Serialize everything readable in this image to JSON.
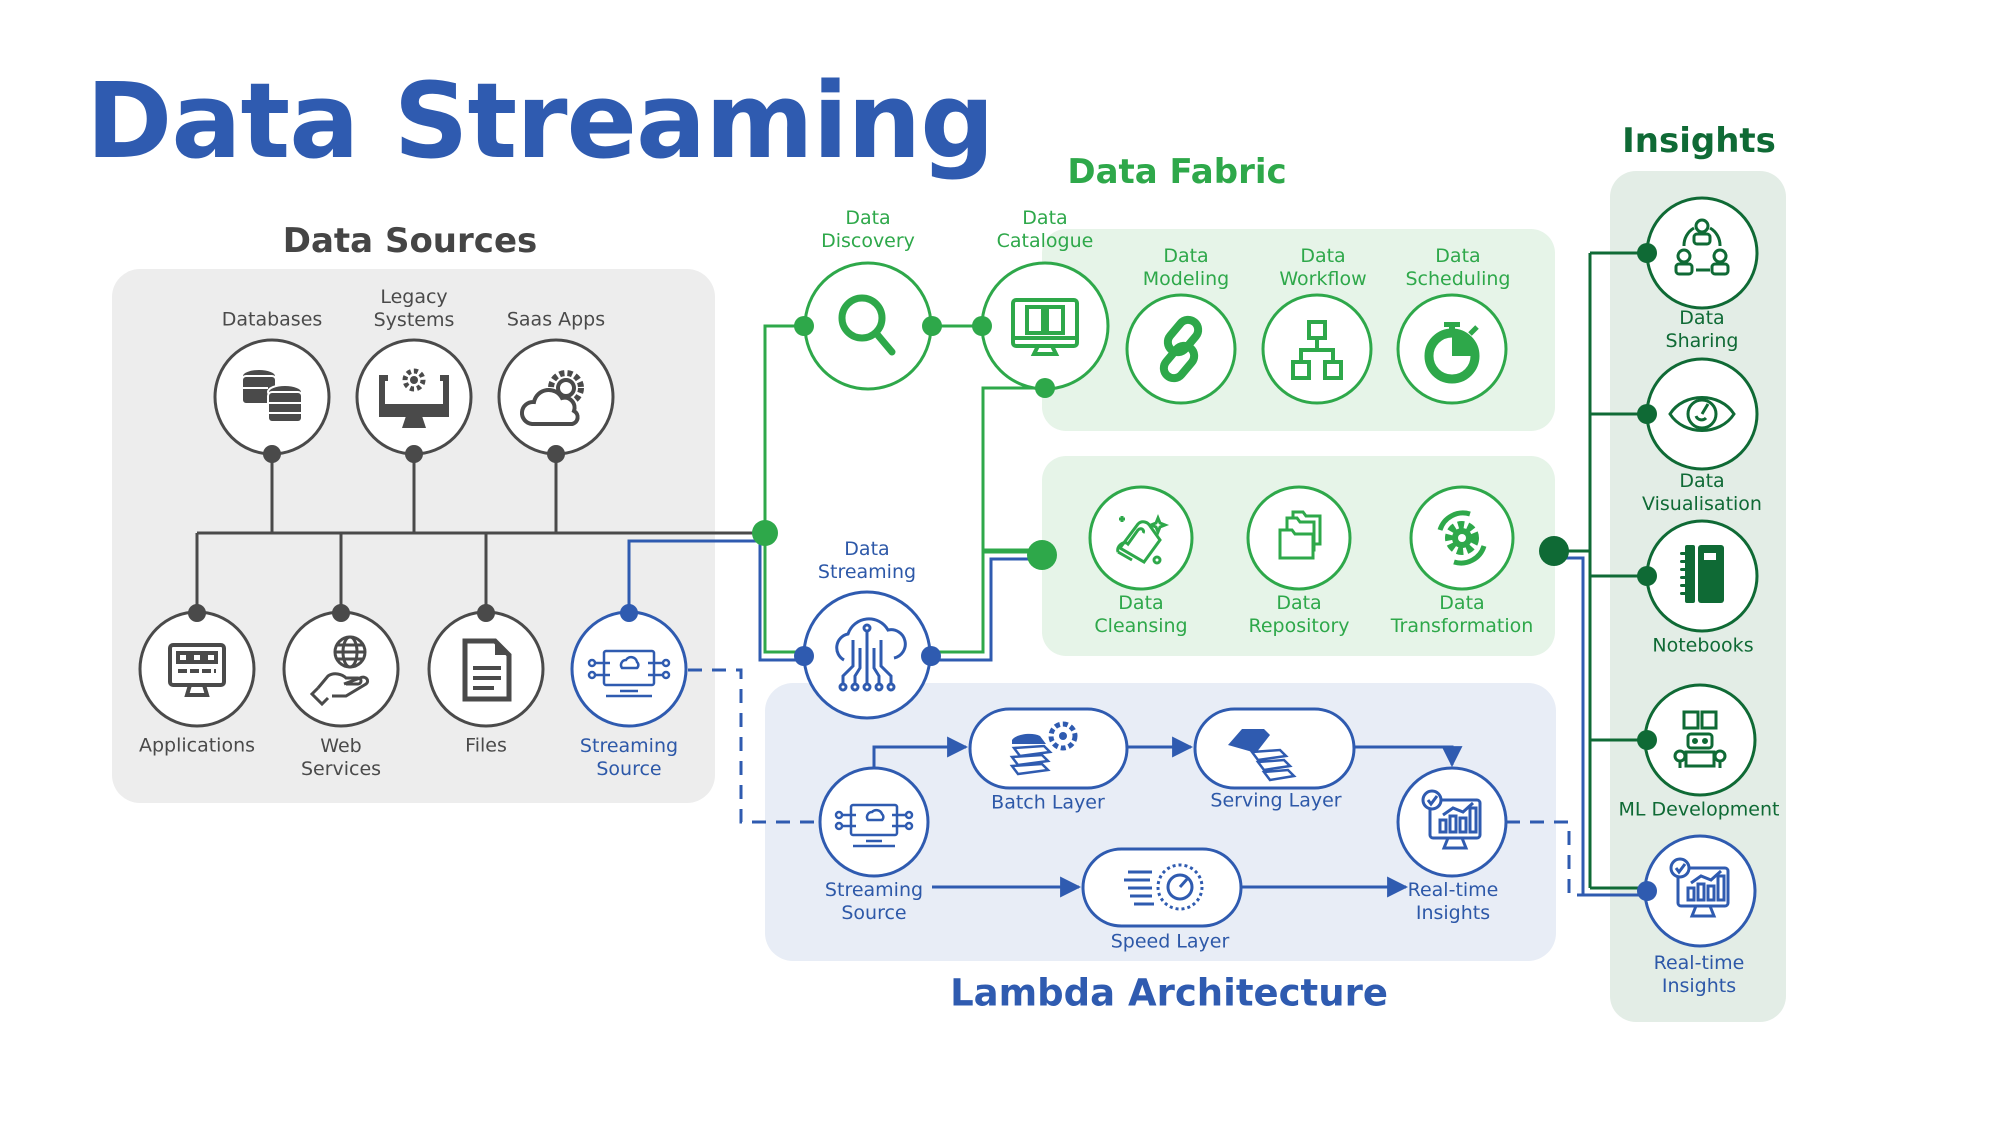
{
  "title": "Data Streaming",
  "colors": {
    "blue": "#2f5bb0",
    "green": "#2ea84a",
    "dark_green": "#0f6a35",
    "gray": "#4a4a4a"
  },
  "data_sources": {
    "heading": "Data Sources",
    "top_nodes": [
      {
        "label": [
          "Databases"
        ],
        "icon": "database-icon"
      },
      {
        "label": [
          "Legacy",
          "Systems"
        ],
        "icon": "computer-gear-icon"
      },
      {
        "label": [
          "Saas Apps"
        ],
        "icon": "cloud-gear-icon"
      }
    ],
    "bottom_nodes": [
      {
        "label": [
          "Applications"
        ],
        "icon": "app-monitor-icon"
      },
      {
        "label": [
          "Web",
          "Services"
        ],
        "icon": "globe-hand-icon"
      },
      {
        "label": [
          "Files"
        ],
        "icon": "document-icon"
      },
      {
        "label": [
          "Streaming",
          "Source"
        ],
        "icon": "streaming-monitor-icon"
      }
    ]
  },
  "data_streaming": {
    "label": [
      "Data",
      "Streaming"
    ],
    "icon": "cloud-circuit-icon"
  },
  "data_fabric": {
    "heading": "Data Fabric",
    "row1": [
      {
        "label": [
          "Data",
          "Discovery"
        ],
        "icon": "search-icon"
      },
      {
        "label": [
          "Data",
          "Catalogue"
        ],
        "icon": "book-monitor-icon"
      },
      {
        "label": [
          "Data",
          "Modeling"
        ],
        "icon": "link-icon"
      },
      {
        "label": [
          "Data",
          "Workflow"
        ],
        "icon": "hierarchy-icon"
      },
      {
        "label": [
          "Data",
          "Scheduling"
        ],
        "icon": "stopwatch-icon"
      }
    ],
    "row2": [
      {
        "label": [
          "Data",
          "Cleansing"
        ],
        "icon": "cleaning-hand-icon"
      },
      {
        "label": [
          "Data",
          "Repository"
        ],
        "icon": "folders-icon"
      },
      {
        "label": [
          "Data",
          "Transformation"
        ],
        "icon": "gear-cycle-icon"
      }
    ]
  },
  "lambda": {
    "heading": "Lambda Architecture",
    "streaming_source": [
      "Streaming",
      "Source"
    ],
    "batch_layer": "Batch Layer",
    "serving_layer": "Serving Layer",
    "speed_layer": "Speed Layer",
    "realtime_insights": [
      "Real-time",
      "Insights"
    ]
  },
  "insights": {
    "heading": "Insights",
    "items": [
      {
        "label": [
          "Data",
          "Sharing"
        ],
        "icon": "people-share-icon"
      },
      {
        "label": [
          "Data",
          "Visualisation"
        ],
        "icon": "eye-chart-icon"
      },
      {
        "label": [
          "Notebooks"
        ],
        "icon": "notebook-icon"
      },
      {
        "label": [
          "ML Development"
        ],
        "icon": "robot-book-icon"
      },
      {
        "label": [
          "Real-time",
          "Insights"
        ],
        "icon": "analytics-monitor-icon"
      }
    ]
  }
}
